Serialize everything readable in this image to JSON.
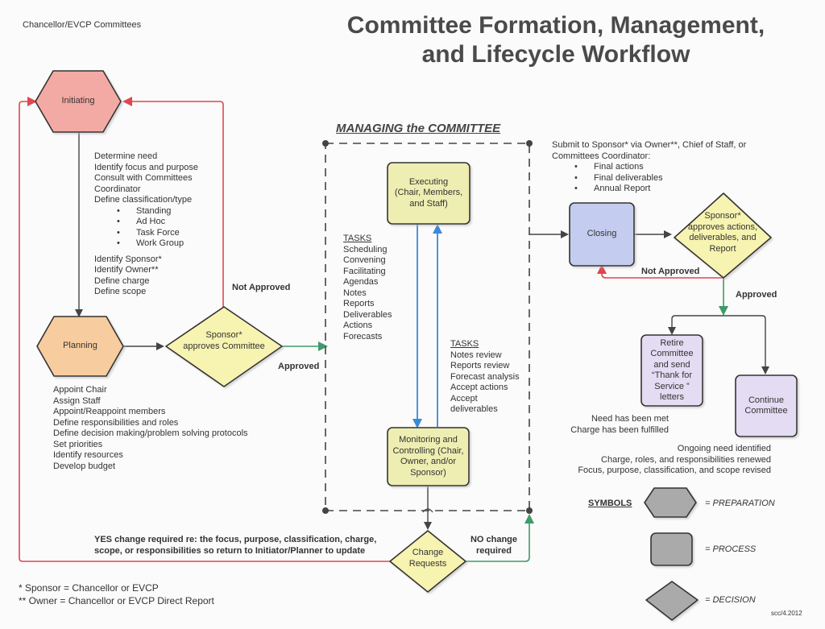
{
  "header": {
    "org_label": "Chancellor/EVCP Committees",
    "title_line1": "Committee Formation, Management,",
    "title_line2": "and Lifecycle Workflow"
  },
  "nodes": {
    "initiating": "Initiating",
    "planning": "Planning",
    "sponsor_approves_committee": [
      "Sponsor*",
      "approves Committee"
    ],
    "executing": [
      "Executing",
      "(Chair, Members,",
      "and Staff)"
    ],
    "monitoring": [
      "Monitoring and",
      "Controlling (Chair,",
      "Owner, and/or",
      "Sponsor)"
    ],
    "change_requests": [
      "Change",
      "Requests"
    ],
    "closing": "Closing",
    "sponsor_approves_actions": [
      "Sponsor*",
      "approves actions,",
      "deliverables, and",
      "Report"
    ],
    "retire": [
      "Retire",
      "Committee",
      "and send",
      "“Thank for",
      "Service ”",
      "letters"
    ],
    "continue": [
      "Continue",
      "Committee"
    ]
  },
  "initiating_tasks": {
    "items": [
      "Determine need",
      "Identify focus and purpose",
      "Consult with Committees",
      "Coordinator",
      "Define classification/type"
    ],
    "types": [
      "Standing",
      "Ad Hoc",
      "Task Force",
      "Work Group"
    ],
    "items2": [
      "Identify Sponsor*",
      "Identify Owner**",
      "Define charge",
      "Define scope"
    ]
  },
  "planning_tasks": [
    "Appoint Chair",
    "Assign Staff",
    "Appoint/Reappoint members",
    "Define responsibilities and roles",
    "Define decision making/problem solving protocols",
    "Set priorities",
    "Identify resources",
    "Develop budget"
  ],
  "managing": {
    "heading": "MANAGING the COMMITTEE",
    "exec_tasks_heading": "TASKS",
    "exec_tasks": [
      "Scheduling",
      "Convening",
      "Facilitating",
      "Agendas",
      "Notes",
      "Reports",
      "Deliverables",
      "Actions",
      "Forecasts"
    ],
    "mon_tasks_heading": "TASKS",
    "mon_tasks": [
      "Notes review",
      "Reports review",
      "Forecast analysis",
      "Accept actions",
      "Accept",
      "deliverables"
    ]
  },
  "closing_submit": {
    "lines": [
      "Submit to Sponsor* via Owner**, Chief of Staff, or",
      "Committees Coordinator:"
    ],
    "items": [
      "Final actions",
      "Final deliverables",
      "Annual Report"
    ]
  },
  "edge_labels": {
    "not_approved_1": "Not Approved",
    "approved_1": "Approved",
    "not_approved_2": "Not Approved",
    "approved_2": "Approved",
    "yes_change": [
      "YES change required re: the focus, purpose, classification, charge,",
      "scope, or responsibilities so return to Initiator/Planner to update"
    ],
    "no_change": [
      "NO change",
      "required"
    ]
  },
  "retire_reasons": [
    "Need has been met",
    "Charge has been fulfilled"
  ],
  "continue_reasons": [
    "Ongoing need identified",
    "Charge, roles, and responsibilities renewed",
    "Focus, purpose, classification, and scope revised"
  ],
  "footnotes": [
    "* Sponsor = Chancellor or EVCP",
    "** Owner = Chancellor or EVCP Direct Report"
  ],
  "legend": {
    "heading": "SYMBOLS",
    "preparation": "= PREPARATION",
    "process": "= PROCESS",
    "decision": "= DECISION"
  },
  "stamp": "scc/4.2012",
  "colors": {
    "initiating": "#f4aaa4",
    "planning": "#f7cc9e",
    "decision": "#f7f3b0",
    "process_yellow": "#eeeeb2",
    "closing": "#c4cdef",
    "purple": "#e3dcf3",
    "red_line": "#e0464f",
    "green_line": "#3f9a6a",
    "blue_line": "#3a8ad6",
    "dark_line": "#444444"
  }
}
